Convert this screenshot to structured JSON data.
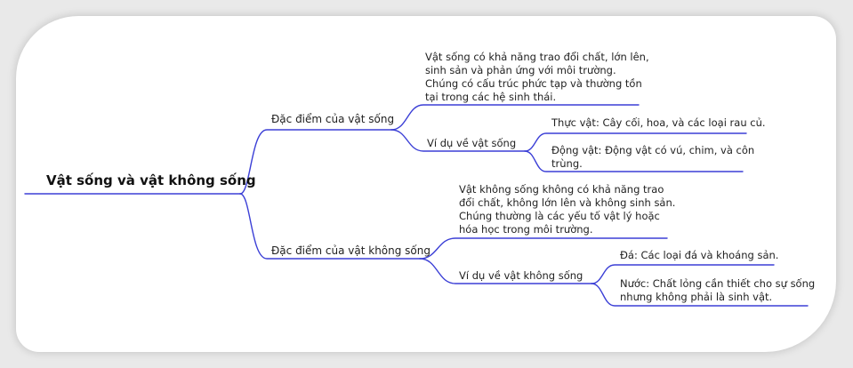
{
  "root": "Vật sống và vật không sống",
  "branches": [
    {
      "label": "Đặc điểm của vật sống",
      "description": [
        "Vật sống có khả năng trao đổi chất, lớn lên,",
        "sinh sản và phản ứng với môi trường.",
        "Chúng có cấu trúc phức tạp và thường tồn",
        "tại trong các hệ sinh thái."
      ],
      "examples_label": "Ví dụ về vật sống",
      "examples": [
        [
          "Thực vật: Cây cối, hoa, và các loại rau củ."
        ],
        [
          "Động vật: Động vật có vú, chim, và côn",
          "trùng."
        ]
      ]
    },
    {
      "label": "Đặc điểm của vật không sống",
      "description": [
        "Vật không sống không có khả năng trao",
        "đổi chất, không lớn lên và không sinh sản.",
        "Chúng thường là các yếu tố vật lý hoặc",
        "hóa học trong môi trường."
      ],
      "examples_label": "Ví dụ về vật không sống",
      "examples": [
        [
          "Đá: Các loại đá và khoáng sản."
        ],
        [
          "Nước: Chất lỏng cần thiết cho sự sống",
          "nhưng không phải là sinh vật."
        ]
      ]
    }
  ],
  "colors": {
    "line": "#3b3fd6",
    "background": "#e9e9e9",
    "card": "#ffffff",
    "text": "#222222"
  }
}
